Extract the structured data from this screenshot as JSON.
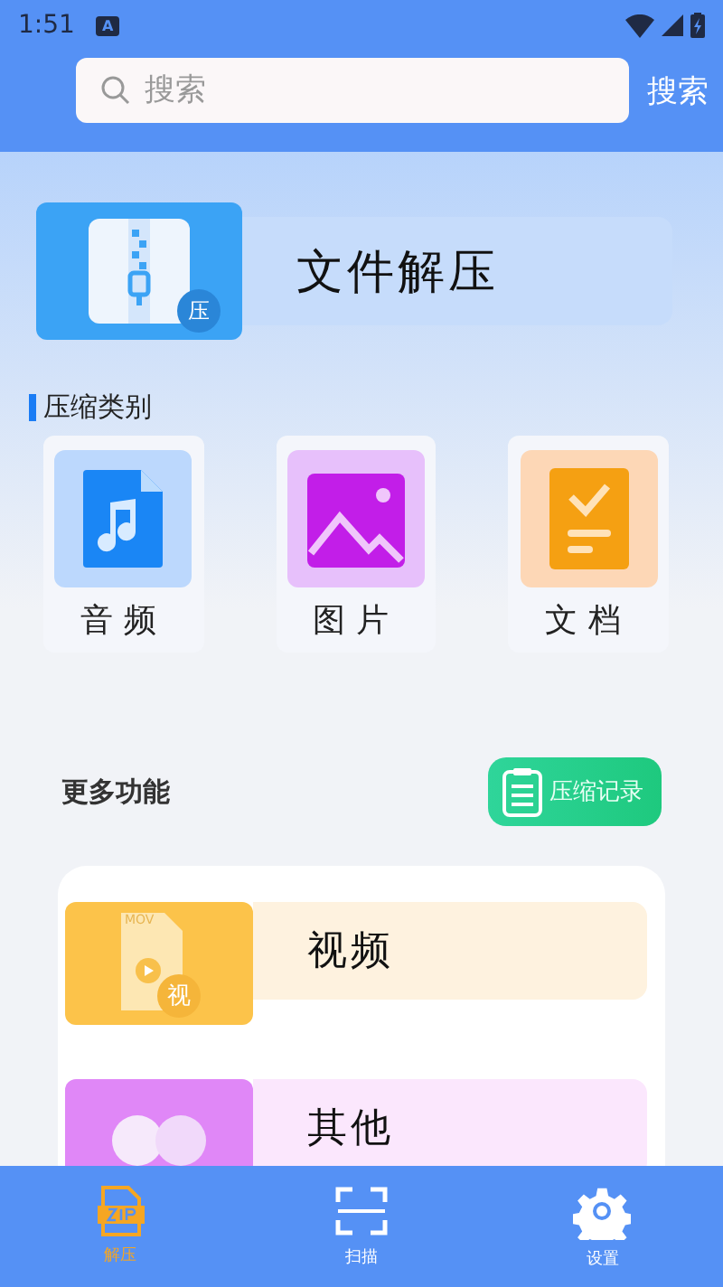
{
  "status_bar": {
    "time": "1:51",
    "notification": "A"
  },
  "search": {
    "placeholder": "搜索",
    "button": "搜索"
  },
  "banner": {
    "title": "文件解压",
    "badge": "压"
  },
  "category_section": {
    "title": "压缩类别"
  },
  "categories": [
    {
      "label": "音频",
      "kind": "audio"
    },
    {
      "label": "图片",
      "kind": "image"
    },
    {
      "label": "文档",
      "kind": "document"
    }
  ],
  "more_section": {
    "title": "更多功能",
    "history_button": "压缩记录"
  },
  "features": [
    {
      "label": "视频",
      "kind": "video",
      "badge": "视",
      "file_type": "MOV"
    },
    {
      "label": "其他",
      "kind": "other"
    }
  ],
  "nav": [
    {
      "label": "解压",
      "kind": "zip",
      "selected": true
    },
    {
      "label": "扫描",
      "kind": "scan",
      "selected": false
    },
    {
      "label": "设置",
      "kind": "settings",
      "selected": false
    }
  ]
}
